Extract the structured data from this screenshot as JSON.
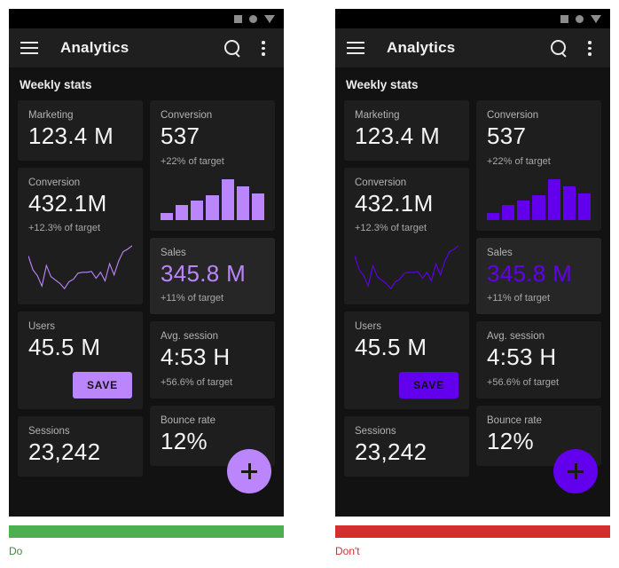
{
  "panels": [
    {
      "verdict": "Do",
      "verdict_color": "#4CAF50",
      "accent": "#BB86FC",
      "statusbar": {
        "icons": [
          "square-icon",
          "circle-icon",
          "triangle-down-icon"
        ]
      },
      "appbar": {
        "menu_icon": "hamburger-menu-icon",
        "title": "Analytics",
        "search_icon": "search-icon",
        "overflow_icon": "more-vert-icon"
      },
      "section_title": "Weekly stats",
      "left_cards": [
        {
          "label": "Marketing",
          "value": "123.4 M"
        },
        {
          "label": "Conversion",
          "value": "432.1M",
          "sub": "+12.3% of target",
          "chart": "line"
        },
        {
          "label": "Users",
          "value": "45.5 M",
          "button": "SAVE"
        },
        {
          "label": "Sessions",
          "value": "23,242"
        }
      ],
      "right_cards": [
        {
          "label": "Conversion",
          "value": "537",
          "sub": "+22% of target",
          "chart": "bar"
        },
        {
          "label": "Sales",
          "value": "345.8 M",
          "sub": "+11% of target",
          "elevated": true,
          "accent_value": true
        },
        {
          "label": "Avg. session",
          "value": "4:53 H",
          "sub": "+56.6% of target"
        },
        {
          "label": "Bounce rate",
          "value": "12%"
        }
      ],
      "fab": {
        "icon": "plus-icon",
        "label": "+"
      }
    },
    {
      "verdict": "Don't",
      "verdict_color": "#D32F2F",
      "accent": "#6200EE",
      "statusbar": {
        "icons": [
          "square-icon",
          "circle-icon",
          "triangle-down-icon"
        ]
      },
      "appbar": {
        "menu_icon": "hamburger-menu-icon",
        "title": "Analytics",
        "search_icon": "search-icon",
        "overflow_icon": "more-vert-icon"
      },
      "section_title": "Weekly stats",
      "left_cards": [
        {
          "label": "Marketing",
          "value": "123.4 M"
        },
        {
          "label": "Conversion",
          "value": "432.1M",
          "sub": "+12.3% of target",
          "chart": "line"
        },
        {
          "label": "Users",
          "value": "45.5 M",
          "button": "SAVE"
        },
        {
          "label": "Sessions",
          "value": "23,242"
        }
      ],
      "right_cards": [
        {
          "label": "Conversion",
          "value": "537",
          "sub": "+22% of target",
          "chart": "bar"
        },
        {
          "label": "Sales",
          "value": "345.8 M",
          "sub": "+11% of target",
          "elevated": true,
          "accent_value": true
        },
        {
          "label": "Avg. session",
          "value": "4:53 H",
          "sub": "+56.6% of target"
        },
        {
          "label": "Bounce rate",
          "value": "12%"
        }
      ],
      "fab": {
        "icon": "plus-icon",
        "label": "+"
      }
    }
  ],
  "chart_data": [
    {
      "type": "bar",
      "title": "Conversion",
      "categories": [
        "1",
        "2",
        "3",
        "4",
        "5",
        "6",
        "7"
      ],
      "values": [
        8,
        17,
        23,
        29,
        48,
        39,
        31
      ],
      "xlabel": "",
      "ylabel": "",
      "ylim": [
        0,
        50
      ],
      "grid": false,
      "legend": null
    },
    {
      "type": "line",
      "title": "Conversion",
      "x": [
        0,
        1,
        2,
        3,
        4,
        5,
        6,
        7,
        8,
        9,
        10,
        11,
        12,
        13,
        14,
        15,
        16,
        17,
        18,
        19,
        20,
        21,
        22,
        23
      ],
      "values": [
        44,
        28,
        21,
        9,
        33,
        20,
        16,
        12,
        6,
        14,
        17,
        24,
        25,
        25,
        26,
        18,
        25,
        15,
        35,
        22,
        38,
        49,
        52,
        56
      ],
      "xlabel": "",
      "ylabel": "",
      "ylim": [
        0,
        60
      ],
      "grid": false,
      "legend": null
    }
  ]
}
